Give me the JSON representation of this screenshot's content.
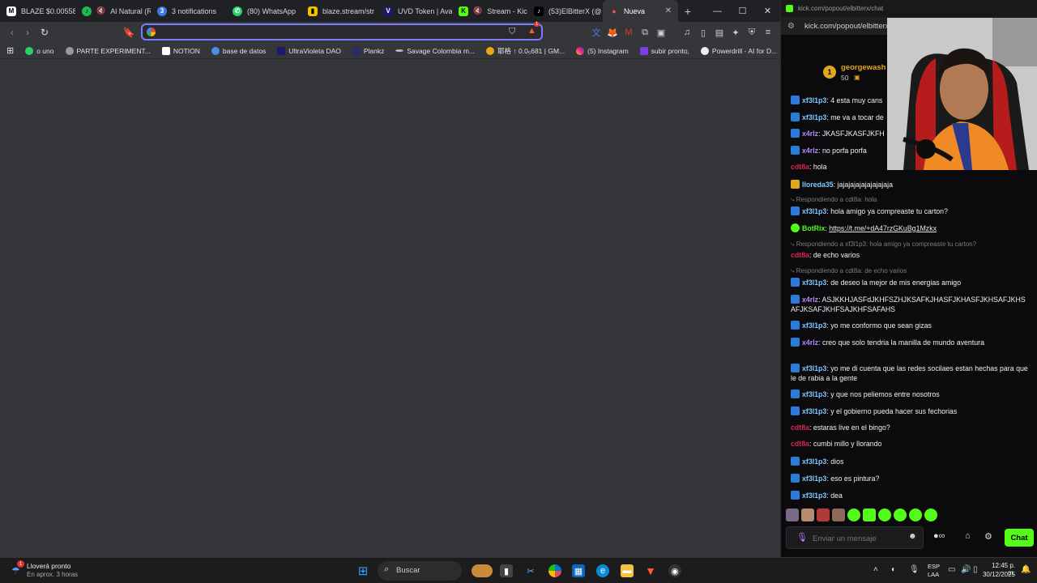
{
  "browser": {
    "tabs": [
      {
        "label": "BLAZE $0.00558",
        "icon": "M"
      },
      {
        "label": "Al Natural (R",
        "icon": "♪"
      },
      {
        "label": "3 notifications",
        "icon": "3"
      },
      {
        "label": "(80) WhatsApp",
        "icon": "✆"
      },
      {
        "label": "blaze.stream/str",
        "icon": "▮"
      },
      {
        "label": "UVD Token | Ava",
        "icon": "V"
      },
      {
        "label": "Stream - Kick",
        "icon": "K"
      },
      {
        "label": "(53)ElBitterX (@",
        "icon": "♪"
      },
      {
        "label": "Nueva",
        "icon": "●"
      }
    ],
    "omnibox": {
      "value": "",
      "placeholder": ""
    },
    "brave_badge": "1",
    "bookmarks": [
      "o uno",
      "PARTE EXPERIMENT...",
      "NOTION",
      "base de datos",
      "UltraVioleta DAO",
      "Plankz",
      "Savage Colombia m...",
      "耶格 ↑ 0.0₅681 | GM...",
      "(5) Instagram",
      "subir pronto,",
      "Powerdrill - AI for D..."
    ]
  },
  "kick": {
    "window_title": "kick.com/popout/elbitterx/chat",
    "url": "kick.com/popout/elbitterx/chat",
    "pinned": {
      "rank": "1",
      "user": "georgewash",
      "count": "50"
    },
    "messages": [
      {
        "user": "xf3l1p3",
        "color": "#7cc8ff",
        "badge": "blue",
        "text": "4 esta muy cans"
      },
      {
        "user": "xf3l1p3",
        "color": "#7cc8ff",
        "badge": "blue",
        "text": "me va a tocar de"
      },
      {
        "user": "x4rlz",
        "color": "#b18cff",
        "badge": "blue",
        "text": "JKASFJKASFJKFH"
      },
      {
        "user": "x4rlz",
        "color": "#b18cff",
        "badge": "blue",
        "text": "no porfa porfa"
      },
      {
        "user": "cdt8a",
        "color": "#d9264f",
        "badge": "",
        "text": "hola"
      },
      {
        "user": "lloreda35",
        "color": "#7cc8ff",
        "badge": "gold",
        "text": "jajajajajajajajajaja"
      },
      {
        "reply": "Respondiendo a cdt8a: hola"
      },
      {
        "user": "xf3l1p3",
        "color": "#7cc8ff",
        "badge": "blue",
        "text": "hola amigo ya compreaste tu carton?"
      },
      {
        "user": "BotRix",
        "color": "#53fc18",
        "badge": "green",
        "text": "https://t.me/+dA47rzGKuBg1Mzkx",
        "link": true
      },
      {
        "reply": "Respondiendo a xf3l1p3: hola amigo ya compreaste tu carton?"
      },
      {
        "user": "cdt8a",
        "color": "#d9264f",
        "badge": "",
        "text": "de echo varios"
      },
      {
        "reply": "Respondiendo a cdt8a: de echo varios"
      },
      {
        "user": "xf3l1p3",
        "color": "#7cc8ff",
        "badge": "blue",
        "text": "de deseo la mejor de mis energias amigo"
      },
      {
        "user": "x4rlz",
        "color": "#b18cff",
        "badge": "blue",
        "text": "ASJKKHJASFdJKHFSZHJKSAFKJHASFJKHASFJKHSAFJKHSAFJKSAFJKHFSAJKHFSAFAHS"
      },
      {
        "user": "xf3l1p3",
        "color": "#7cc8ff",
        "badge": "blue",
        "text": "yo me conformo que sean gizas"
      },
      {
        "user": "x4rlz",
        "color": "#b18cff",
        "badge": "blue",
        "text": "creo que solo tendria la manilla de mundo aventura"
      },
      {
        "user": "xf3l1p3",
        "color": "#7cc8ff",
        "badge": "blue",
        "text": "yo me di cuenta que las redes socilaes estan hechas para que le de rabia a la gente"
      },
      {
        "user": "xf3l1p3",
        "color": "#7cc8ff",
        "badge": "blue",
        "text": "y que nos peliemos entre nosotros"
      },
      {
        "user": "xf3l1p3",
        "color": "#7cc8ff",
        "badge": "blue",
        "text": "y el gobierno pueda hacer sus fechorias"
      },
      {
        "user": "cdt8a",
        "color": "#d9264f",
        "badge": "",
        "text": "estaras live en el bingo?"
      },
      {
        "user": "cdt8a",
        "color": "#d9264f",
        "badge": "",
        "text": "cumbi millo y llorando"
      },
      {
        "user": "xf3l1p3",
        "color": "#7cc8ff",
        "badge": "blue",
        "text": "dios"
      },
      {
        "user": "xf3l1p3",
        "color": "#7cc8ff",
        "badge": "blue",
        "text": "eso es pintura?"
      },
      {
        "user": "xf3l1p3",
        "color": "#7cc8ff",
        "badge": "blue",
        "text": "dea"
      }
    ],
    "input_placeholder": "Enviar un mensaje",
    "chat_button": "Chat"
  },
  "taskbar": {
    "weather_title": "Lloverá pronto",
    "weather_sub": "En aprox. 3 horas",
    "weather_badge": "1",
    "search_label": "Buscar",
    "lang_top": "ESP",
    "lang_bottom": "LAA",
    "time": "12:45 p. m.",
    "date": "30/12/2025"
  }
}
